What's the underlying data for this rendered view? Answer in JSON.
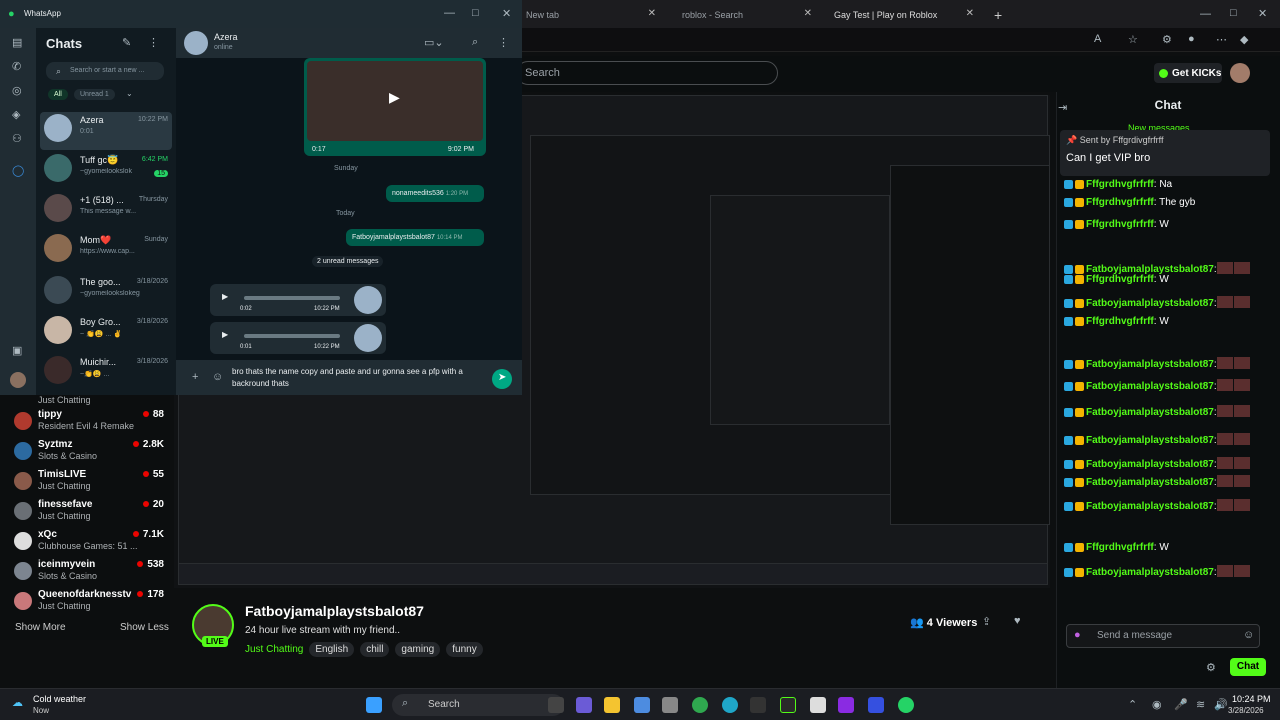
{
  "browser": {
    "tabs": [
      {
        "label": "New tab"
      },
      {
        "label": "roblox - Search"
      },
      {
        "label": "Gay Test | Play on Roblox"
      }
    ],
    "add_tab": "+"
  },
  "kick": {
    "search_placeholder": "Search",
    "get_kicks": "Get KICKs",
    "sidebar": {
      "items": [
        {
          "name": "Just Chatting",
          "category": "",
          "viewers": ""
        },
        {
          "name": "tippy",
          "category": "Resident Evil 4 Remake",
          "viewers": "88"
        },
        {
          "name": "Syztmz",
          "category": "Slots & Casino",
          "viewers": "2.8K"
        },
        {
          "name": "TimisLIVE",
          "category": "Just Chatting",
          "viewers": "55"
        },
        {
          "name": "finessefave",
          "category": "Just Chatting",
          "viewers": "20"
        },
        {
          "name": "xQc",
          "category": "Clubhouse Games: 51 ...",
          "viewers": "7.1K"
        },
        {
          "name": "iceinmyvein",
          "category": "Slots & Casino",
          "viewers": "538"
        },
        {
          "name": "Queenofdarknesstv",
          "category": "Just Chatting",
          "viewers": "178"
        }
      ],
      "show_more": "Show More",
      "show_less": "Show Less"
    },
    "stream": {
      "title": "Fatboyjamalplaystsbalot87",
      "description": "24 hour live stream with my friend..",
      "live": "LIVE",
      "category": "Just Chatting",
      "tags": [
        "English",
        "chill",
        "gaming",
        "funny"
      ],
      "viewers": "4 Viewers"
    },
    "chat": {
      "header": "Chat",
      "new_messages": "New messages",
      "pinned_sent_by": "Sent by",
      "pinned_user": "Fffgrdivgfrfrff",
      "pinned_message": "Can I get VIP bro",
      "messages": [
        {
          "user": "Fffgrdhvgfrfrff",
          "text": ": Na",
          "color": "#53fc18"
        },
        {
          "user": "Fffgrdhvgfrfrff",
          "text": ": The gyb",
          "color": "#53fc18"
        },
        {
          "user": "Fffgrdhvgfrfrff",
          "text": ": W",
          "color": "#53fc18"
        },
        {
          "user": "Fatboyjamalplaystsbalot87",
          "text": ":",
          "color": "#53fc18"
        },
        {
          "user": "Fffgrdhvgfrfrff",
          "text": ": W",
          "color": "#53fc18"
        },
        {
          "user": "Fatboyjamalplaystsbalot87",
          "text": ":",
          "color": "#53fc18"
        },
        {
          "user": "Fffgrdhvgfrfrff",
          "text": ": W",
          "color": "#53fc18"
        },
        {
          "user": "Fatboyjamalplaystsbalot87",
          "text": ":",
          "color": "#53fc18"
        },
        {
          "user": "Fatboyjamalplaystsbalot87",
          "text": ":",
          "color": "#53fc18"
        },
        {
          "user": "Fatboyjamalplaystsbalot87",
          "text": ":",
          "color": "#53fc18"
        },
        {
          "user": "Fatboyjamalplaystsbalot87",
          "text": ":",
          "color": "#53fc18"
        },
        {
          "user": "Fatboyjamalplaystsbalot87",
          "text": ":",
          "color": "#53fc18"
        },
        {
          "user": "Fatboyjamalplaystsbalot87",
          "text": ":",
          "color": "#53fc18"
        },
        {
          "user": "Fatboyjamalplaystsbalot87",
          "text": ":",
          "color": "#53fc18"
        },
        {
          "user": "Fffgrdhvgfrfrff",
          "text": ": W",
          "color": "#53fc18"
        },
        {
          "user": "Fatboyjamalplaystsbalot87",
          "text": ":",
          "color": "#53fc18"
        }
      ],
      "send_placeholder": "Send a message",
      "chat_button": "Chat"
    }
  },
  "whatsapp": {
    "app_title": "WhatsApp",
    "chats_title": "Chats",
    "search_placeholder": "Search or start a new ...",
    "filters": [
      "All",
      "Unread 1"
    ],
    "chats": [
      {
        "name": "Azera",
        "preview": "0:01",
        "time": "10:22 PM"
      },
      {
        "name": "Tuff gc😇",
        "preview": "~gyomeilookslok",
        "time": "6:42 PM"
      },
      {
        "name": "+1 (518) ...",
        "preview": "This message w...",
        "time": "Thursday"
      },
      {
        "name": "Mom❤️",
        "preview": "https://www.cap...",
        "time": "Sunday"
      },
      {
        "name": "The goo...",
        "preview": "~gyomeilookslokeg",
        "time": "3/18/2026"
      },
      {
        "name": "Boy Gro...",
        "preview": "~ 👏😩 ... ✌️",
        "time": "3/18/2026"
      },
      {
        "name": "Muichir...",
        "preview": "~👏😩 ...",
        "time": "3/18/2026"
      }
    ],
    "unread_badge": "15",
    "contact": {
      "name": "Azera",
      "status": "online"
    },
    "video": {
      "duration": "0:17",
      "time": "9:02 PM"
    },
    "day_sunday": "Sunday",
    "msg1": {
      "text": "nonameedits536",
      "time": "1:20 PM"
    },
    "day_today": "Today",
    "msg2": {
      "text": "Fatboyjamalplaystsbalot87",
      "time": "10:14 PM"
    },
    "unread_divider": "2 unread messages",
    "voice1": {
      "duration": "0:02",
      "time": "10:22 PM"
    },
    "voice2": {
      "duration": "0:01",
      "time": "10:22 PM"
    },
    "compose_text": "bro thats the name copy and paste and ur gonna see a pfp with a backround thats"
  },
  "taskbar": {
    "weather_title": "Cold weather",
    "weather_sub": "Now",
    "search": "Search",
    "time": "10:24 PM",
    "date": "3/28/2026"
  }
}
